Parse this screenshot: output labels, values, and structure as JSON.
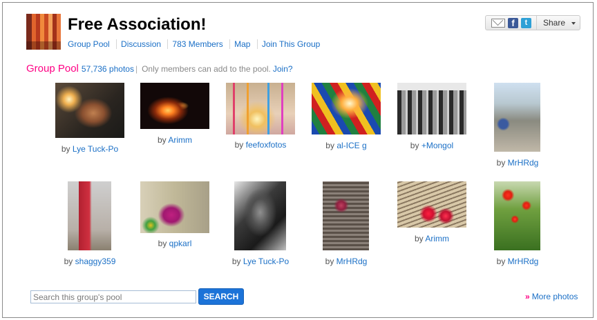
{
  "group": {
    "title": "Free Association!",
    "icon": "group-avatar-icon"
  },
  "subnav": [
    {
      "label": "Group Pool"
    },
    {
      "label": "Discussion"
    },
    {
      "label": "783 Members"
    },
    {
      "label": "Map"
    },
    {
      "label": "Join This Group"
    }
  ],
  "share": {
    "label": "Share",
    "icons": [
      "email-icon",
      "facebook-icon",
      "twitter-icon",
      "chevron-down-icon"
    ]
  },
  "pool": {
    "heading": "Group Pool",
    "count": "57,736 photos",
    "separator": "|",
    "note": "Only members can add to the pool.",
    "join_link": "Join?"
  },
  "photos": [
    {
      "by": "by",
      "author": "Lye Tuck-Po"
    },
    {
      "by": "by",
      "author": "Arimm"
    },
    {
      "by": "by",
      "author": "feefoxfotos"
    },
    {
      "by": "by",
      "author": "al-ICE g"
    },
    {
      "by": "by",
      "author": "+Mongol"
    },
    {
      "by": "by",
      "author": "MrHRdg"
    },
    {
      "by": "by",
      "author": "shaggy359"
    },
    {
      "by": "by",
      "author": "qpkarl"
    },
    {
      "by": "by",
      "author": "Lye Tuck-Po"
    },
    {
      "by": "by",
      "author": "MrHRdg"
    },
    {
      "by": "by",
      "author": "Arimm"
    },
    {
      "by": "by",
      "author": "MrHRdg"
    }
  ],
  "search": {
    "placeholder": "Search this group's pool",
    "button": "SEARCH"
  },
  "more": {
    "chevron": "»",
    "label": "More photos"
  },
  "colors": {
    "link": "#1a6fc6",
    "accent": "#ff0084",
    "button": "#1c73d8"
  }
}
